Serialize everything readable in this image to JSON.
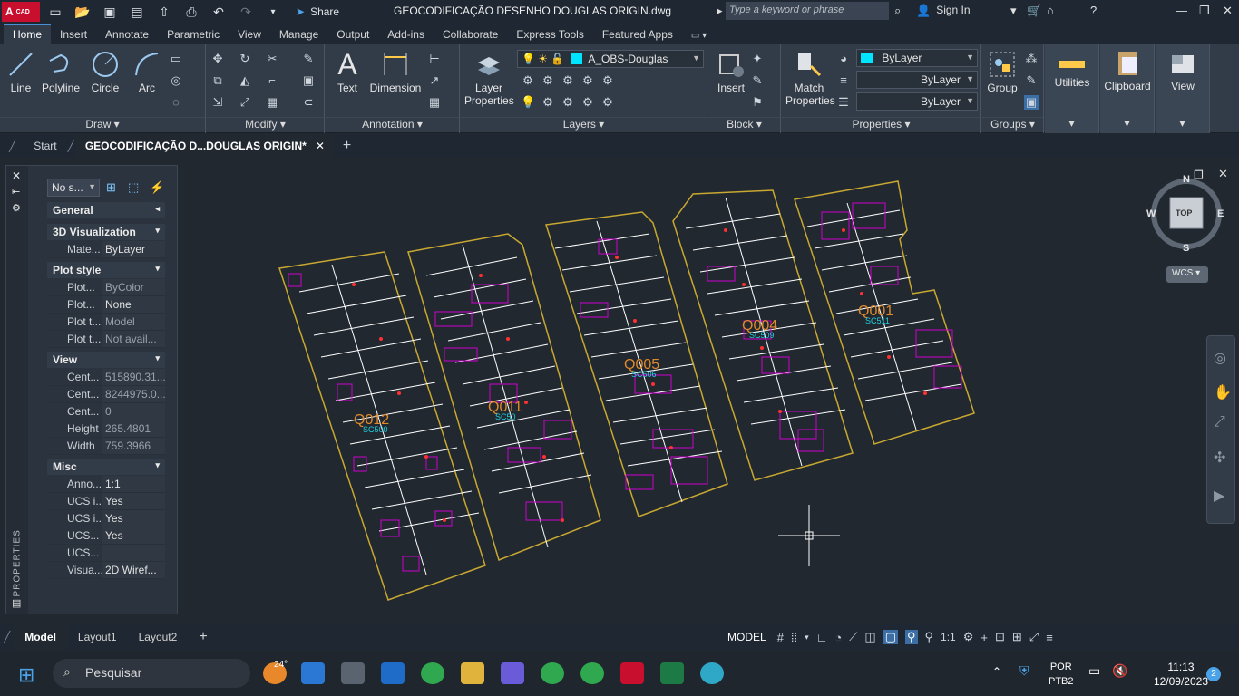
{
  "app": {
    "logo_text": "A",
    "logo_sub": "CAD",
    "share_label": "Share",
    "document_title": "GEOCODIFICAÇÃO DESENHO DOUGLAS ORIGIN.dwg",
    "search_placeholder": "Type a keyword or phrase",
    "sign_in_label": "Sign In"
  },
  "ribbon_tabs": [
    "Home",
    "Insert",
    "Annotate",
    "Parametric",
    "View",
    "Manage",
    "Output",
    "Add-ins",
    "Collaborate",
    "Express Tools",
    "Featured Apps"
  ],
  "ribbon": {
    "draw": {
      "title": "Draw",
      "line": "Line",
      "polyline": "Polyline",
      "circle": "Circle",
      "arc": "Arc"
    },
    "modify": {
      "title": "Modify"
    },
    "annotation": {
      "title": "Annotation",
      "text": "Text",
      "dimension": "Dimension"
    },
    "layers": {
      "title": "Layers",
      "layer_properties": "Layer\nProperties",
      "current_layer": "A_OBS-Douglas"
    },
    "block": {
      "title": "Block",
      "insert": "Insert"
    },
    "properties": {
      "title": "Properties",
      "match": "Match\nProperties",
      "color": "ByLayer",
      "linetype": "ByLayer",
      "lineweight": "ByLayer"
    },
    "groups": {
      "title": "Groups",
      "group": "Group"
    },
    "utilities": "Utilities",
    "clipboard": "Clipboard",
    "view": "View"
  },
  "doc_tabs": {
    "start": "Start",
    "active": "GEOCODIFICAÇÃO D...DOUGLAS ORIGIN*"
  },
  "properties_panel": {
    "side_label": "PROPERTIES",
    "selection": "No s...",
    "sections": {
      "general": "General",
      "visualization": "3D Visualization",
      "plot_style": "Plot style",
      "view": "View",
      "misc": "Misc"
    },
    "rows": [
      {
        "k": "Mate...",
        "v": "ByLayer",
        "dim": false
      },
      {
        "k": "Plot...",
        "v": "ByColor",
        "dim": true
      },
      {
        "k": "Plot...",
        "v": "None",
        "dim": false
      },
      {
        "k": "Plot t...",
        "v": "Model",
        "dim": true
      },
      {
        "k": "Plot t...",
        "v": "Not avail...",
        "dim": true
      },
      {
        "k": "Cent...",
        "v": "515890.31...",
        "dim": true
      },
      {
        "k": "Cent...",
        "v": "8244975.0...",
        "dim": true
      },
      {
        "k": "Cent...",
        "v": "0",
        "dim": true
      },
      {
        "k": "Height",
        "v": "265.4801",
        "dim": true
      },
      {
        "k": "Width",
        "v": "759.3966",
        "dim": true
      },
      {
        "k": "Anno...",
        "v": "1:1",
        "dim": false
      },
      {
        "k": "UCS i...",
        "v": "Yes",
        "dim": false
      },
      {
        "k": "UCS i...",
        "v": "Yes",
        "dim": false
      },
      {
        "k": "UCS...",
        "v": "Yes",
        "dim": false
      },
      {
        "k": "UCS...",
        "v": "",
        "dim": false
      },
      {
        "k": "Visua...",
        "v": "2D Wiref...",
        "dim": false
      }
    ]
  },
  "viewcube": {
    "top": "TOP",
    "n": "N",
    "s": "S",
    "e": "E",
    "w": "W",
    "wcs": "WCS"
  },
  "drawing": {
    "blocks": [
      {
        "code": "Q012",
        "sector": "SC500"
      },
      {
        "code": "Q011",
        "sector": "SC50"
      },
      {
        "code": "Q005",
        "sector": "SC506"
      },
      {
        "code": "Q004",
        "sector": "SC509"
      },
      {
        "code": "Q001",
        "sector": "SC511"
      }
    ]
  },
  "layout_tabs": [
    "Model",
    "Layout1",
    "Layout2"
  ],
  "status": {
    "model": "MODEL",
    "scale": "1:1"
  },
  "taskbar": {
    "search": "Pesquisar",
    "weather": "24°",
    "lang1": "POR",
    "lang2": "PTB2",
    "time": "11:13",
    "date": "12/09/2023",
    "badge": "2"
  }
}
